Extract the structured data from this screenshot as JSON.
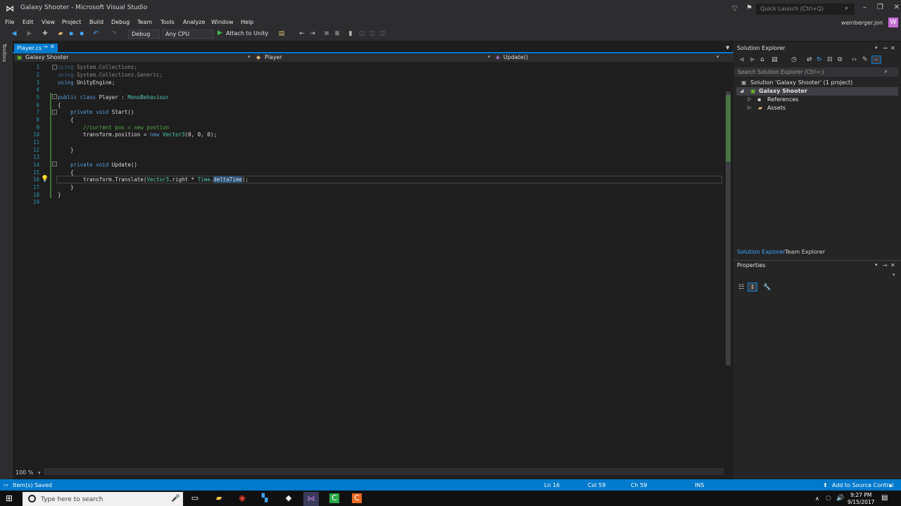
{
  "window": {
    "title": "Galaxy Shooter - Microsoft Visual Studio",
    "quick_launch_placeholder": "Quick Launch (Ctrl+Q)",
    "user": "weinberger.jon",
    "avatar_letter": "W"
  },
  "menu": [
    "File",
    "Edit",
    "View",
    "Project",
    "Build",
    "Debug",
    "Team",
    "Tools",
    "Analyze",
    "Window",
    "Help"
  ],
  "toolbar": {
    "config": "Debug",
    "platform": "Any CPU",
    "attach_label": "Attach to Unity"
  },
  "toolbox_label": "Toolbox",
  "document": {
    "tab_label": "Player.cs",
    "nav_project": "Galaxy Shooter",
    "nav_class": "Player",
    "nav_member": "Update()",
    "zoom": "100 %"
  },
  "code_lines": [
    "using System.Collections;",
    "using System.Collections.Generic;",
    "using UnityEngine;",
    "",
    "public class Player : MonoBehaviour",
    "{",
    "    private void Start()",
    "    {",
    "        //current pos = new postion",
    "        transform.position = new Vector3(0, 0, 0);",
    "",
    "    }",
    "",
    "    private void Update()",
    "    {",
    "        transform.Translate(Vector3.right * Time.deltaTime);",
    "    }",
    "}",
    ""
  ],
  "solution_explorer": {
    "title": "Solution Explorer",
    "search_placeholder": "Search Solution Explorer (Ctrl+;)",
    "solution": "Solution 'Galaxy Shooter' (1 project)",
    "project": "Galaxy Shooter",
    "items": [
      "References",
      "Assets"
    ],
    "tab_solution": "Solution Explorer",
    "tab_team": "Team Explorer"
  },
  "properties": {
    "title": "Properties"
  },
  "status": {
    "message": "Item(s) Saved",
    "ln": "Ln 16",
    "col": "Col 59",
    "ch": "Ch 59",
    "mode": "INS",
    "source_control": "Add to Source Control"
  },
  "taskbar": {
    "search_placeholder": "Type here to search",
    "time": "9:27 PM",
    "date": "9/15/2017"
  },
  "colors": {
    "accent": "#007acc",
    "keyword": "#569cd6",
    "type": "#4ec9b0",
    "comment": "#57a64a",
    "line_number": "#2b91af"
  }
}
